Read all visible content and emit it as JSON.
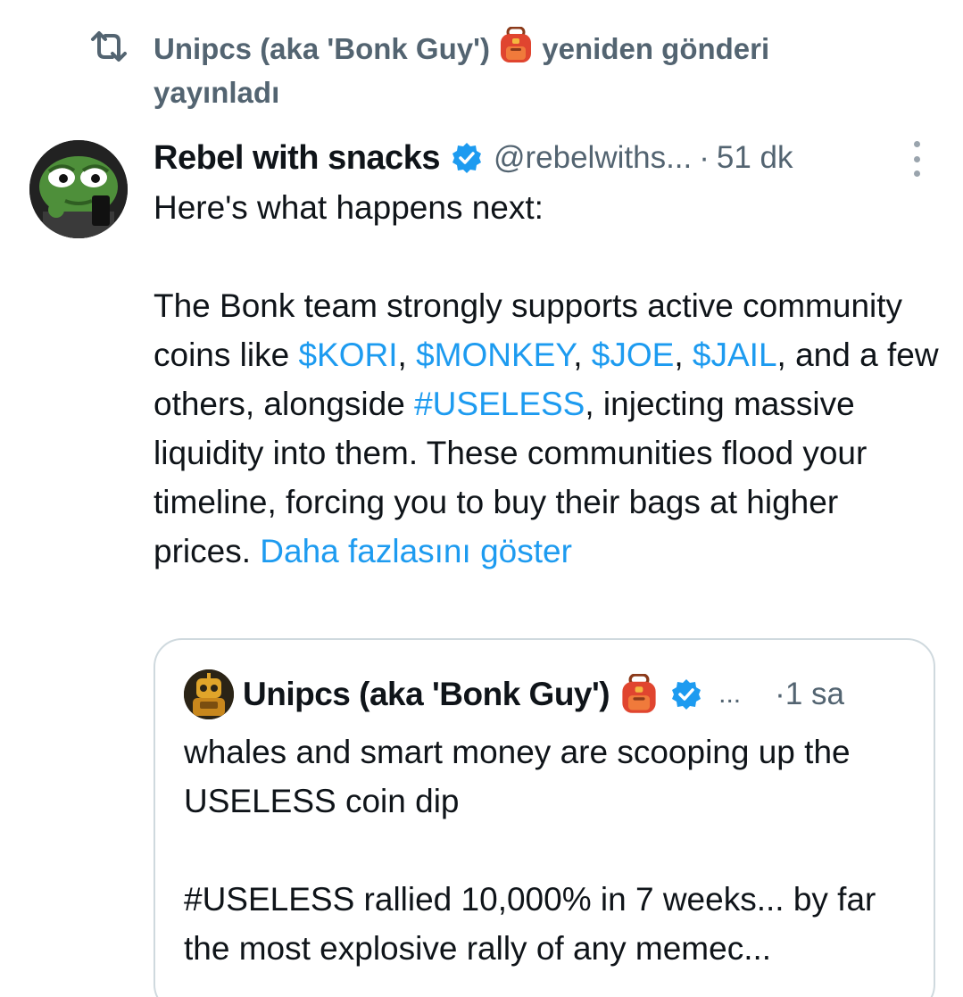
{
  "repost": {
    "icon": "repost-icon",
    "name": "Unipcs (aka 'Bonk Guy')",
    "emoji": "backpack-emoji",
    "action": "yeniden gönderi yayınladı"
  },
  "tweet": {
    "display_name": "Rebel with snacks",
    "handle": "@rebelwiths...",
    "separator": "·",
    "time": "51 dk",
    "line_intro": "Here's what happens next:",
    "body": {
      "p1_a": "The Bonk team strongly supports active community coins like ",
      "tag_kori": "$KORI",
      "comma1": ", ",
      "tag_monkey": "$MONKEY",
      "comma2": ", ",
      "tag_joe": "$JOE",
      "comma3": ", ",
      "tag_jail": "$JAIL",
      "p1_b": ", and a few others, alongside ",
      "tag_useless": "#USELESS",
      "p1_c": ", injecting massive liquidity into them. These communities flood your timeline, forcing you to buy their bags at higher prices. ",
      "show_more": "Daha fazlasını göster"
    }
  },
  "quote": {
    "display_name": "Unipcs (aka 'Bonk Guy')",
    "ellipsis": "...",
    "separator": "·",
    "time": "1 sa",
    "line1": "whales and smart money are scooping up the USELESS coin dip",
    "line2": "#USELESS rallied 10,000% in 7 weeks... by far the most explosive rally of any memec..."
  },
  "colors": {
    "link": "#1d9bf0",
    "muted": "#536471",
    "text": "#0f1419",
    "border": "#cfd9de",
    "verified": "#1d9bf0"
  }
}
